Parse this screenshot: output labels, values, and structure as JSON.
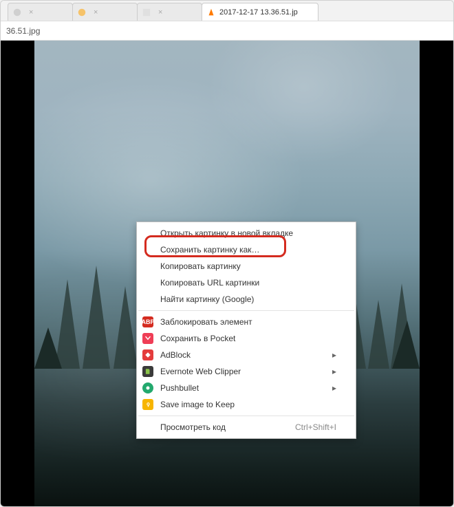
{
  "tabs": {
    "t0": {
      "title": ""
    },
    "t1": {
      "title": ""
    },
    "t2": {
      "title": ""
    },
    "t3": {
      "title": "2017-12-17 13.36.51.jp"
    }
  },
  "title_bar": {
    "text": "36.51.jpg"
  },
  "context_menu": {
    "open_new_tab": "Открыть картинку в новой вкладке",
    "save_as": "Сохранить картинку как…",
    "copy_image": "Копировать картинку",
    "copy_image_url": "Копировать URL картинки",
    "search_image": "Найти картинку (Google)",
    "block_element": "Заблокировать элемент",
    "save_pocket": "Сохранить в Pocket",
    "adblock": "AdBlock",
    "evernote": "Evernote Web Clipper",
    "pushbullet": "Pushbullet",
    "save_keep": "Save image to Keep",
    "inspect": "Просмотреть код",
    "inspect_shortcut": "Ctrl+Shift+I"
  },
  "icons": {
    "abp": {
      "bg": "#d42b1f",
      "label": "ABP"
    },
    "pocket": {
      "bg": "#ef3e56"
    },
    "adblock": {
      "bg": "#e43c3c"
    },
    "evernote": {
      "bg": "#3a3a3a"
    },
    "pushbullet": {
      "bg": "#23a96e"
    },
    "keep": {
      "bg": "#f7b500"
    },
    "vlc": {
      "bg": "#ff7a00"
    }
  }
}
